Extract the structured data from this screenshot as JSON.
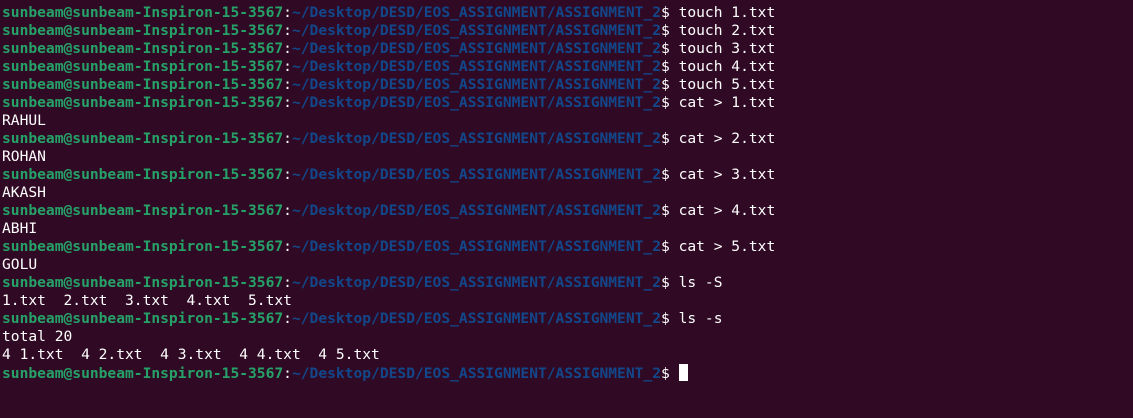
{
  "prompt": {
    "user": "sunbeam@sunbeam-Inspiron-15-3567",
    "colon": ":",
    "path": "~/Desktop/DESD/EOS_ASSIGNMENT/ASSIGNMENT_2",
    "dollar": "$ "
  },
  "lines": [
    {
      "type": "cmd",
      "text": "touch 1.txt"
    },
    {
      "type": "cmd",
      "text": "touch 2.txt"
    },
    {
      "type": "cmd",
      "text": "touch 3.txt"
    },
    {
      "type": "cmd",
      "text": "touch 4.txt"
    },
    {
      "type": "cmd",
      "text": "touch 5.txt"
    },
    {
      "type": "cmd",
      "text": "cat > 1.txt"
    },
    {
      "type": "out",
      "text": "RAHUL"
    },
    {
      "type": "cmd",
      "text": "cat > 2.txt"
    },
    {
      "type": "out",
      "text": "ROHAN"
    },
    {
      "type": "cmd",
      "text": "cat > 3.txt"
    },
    {
      "type": "out",
      "text": "AKASH"
    },
    {
      "type": "cmd",
      "text": "cat > 4.txt"
    },
    {
      "type": "out",
      "text": "ABHI"
    },
    {
      "type": "cmd",
      "text": "cat > 5.txt"
    },
    {
      "type": "out",
      "text": "GOLU"
    },
    {
      "type": "cmd",
      "text": "ls -S"
    },
    {
      "type": "out",
      "text": "1.txt  2.txt  3.txt  4.txt  5.txt"
    },
    {
      "type": "cmd",
      "text": "ls -s"
    },
    {
      "type": "out",
      "text": "total 20"
    },
    {
      "type": "out",
      "text": "4 1.txt  4 2.txt  4 3.txt  4 4.txt  4 5.txt"
    },
    {
      "type": "cmd",
      "text": "",
      "cursor": true
    }
  ],
  "colors": {
    "background": "#300a24",
    "user": "#26a269",
    "path": "#12488b",
    "text": "#ffffff"
  }
}
